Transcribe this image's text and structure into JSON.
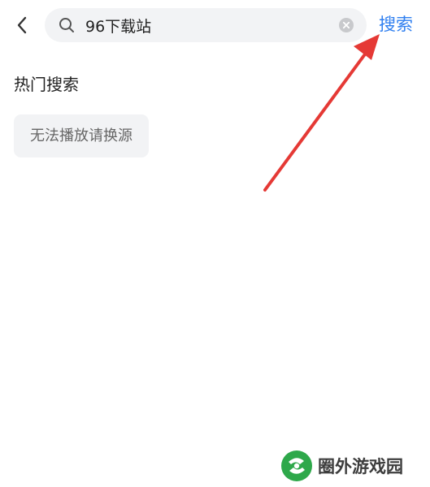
{
  "search": {
    "value": "96下载站",
    "submit_label": "搜索"
  },
  "hot_search": {
    "title": "热门搜索",
    "tags": [
      "无法播放请换源"
    ]
  },
  "watermark": {
    "text": "圈外游戏园"
  },
  "colors": {
    "accent": "#2f7ff0",
    "arrow": "#e53935",
    "tag_bg": "#f2f3f5",
    "logo_green": "#2ea84a"
  },
  "icons": {
    "back": "chevron-left-icon",
    "search": "search-icon",
    "clear": "clear-icon"
  }
}
